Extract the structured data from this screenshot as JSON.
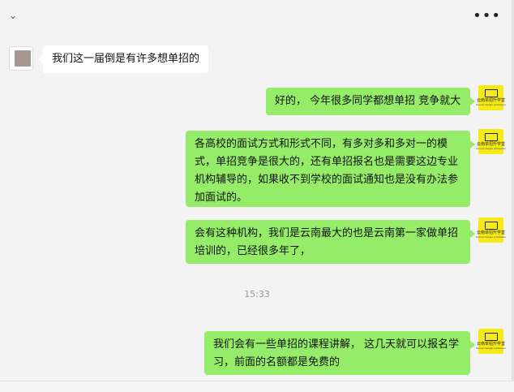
{
  "header": {
    "back_glyph": "⌄",
    "more_glyph": "•••",
    "back_icon": "chevron-down-icon",
    "more_icon": "more-dots-icon"
  },
  "contact_avatar": {
    "logo_text": "云南单招升学堂",
    "logo_sub": "Yunnan Single Admission"
  },
  "messages": [
    {
      "side": "left",
      "text": "我们这一届倒是有许多想单招的"
    },
    {
      "side": "right",
      "text": "好的， 今年很多同学都想单招 竞争就大"
    },
    {
      "side": "right",
      "text": "各高校的面试方式和形式不同，有多对多和多对一的模式，单招竞争是很大的，还有单招报名也是需要这边专业机构辅导的，如果收不到学校的面试通知也是没有办法参加面试的。"
    },
    {
      "side": "right",
      "text": "会有这种机构，我们是云南最大的也是云南第一家做单招培训的，已经很多年了，"
    },
    {
      "side": "right",
      "text": "我们会有一些单招的课程讲解， 这几天就可以报名学习，前面的名额都是免费的"
    }
  ],
  "timestamp": "15:33",
  "colors": {
    "background": "#f3f3f3",
    "bubble_green": "#95ec69",
    "bubble_white": "#ffffff",
    "avatar_yellow": "#f5ea18"
  }
}
